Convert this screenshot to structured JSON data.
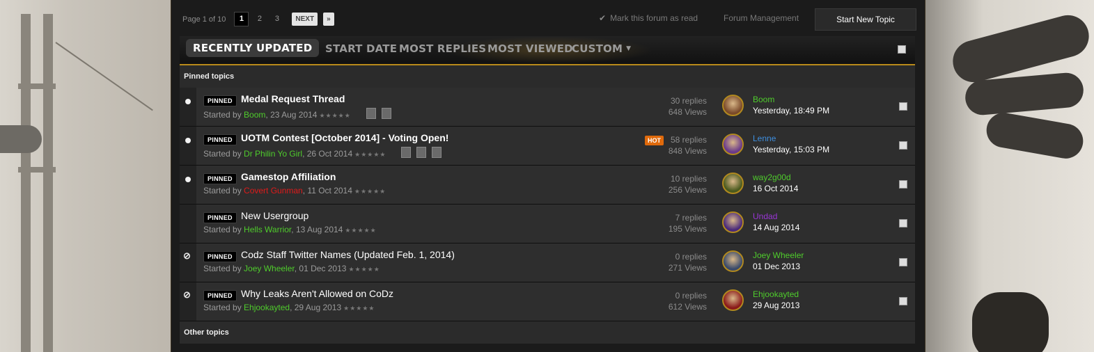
{
  "pagination": {
    "label": "Page 1 of 10",
    "pages": [
      "1",
      "2",
      "3"
    ],
    "next_label": "NEXT",
    "last_label": "»"
  },
  "actions": {
    "mark_read": "Mark this forum as read",
    "forum_management": "Forum Management",
    "start_new_topic": "Start New Topic"
  },
  "tabs": [
    "RECENTLY UPDATED",
    "START DATE",
    "MOST REPLIES",
    "MOST VIEWED",
    "CUSTOM"
  ],
  "sections": {
    "pinned": "Pinned topics",
    "other": "Other topics"
  },
  "badges": {
    "pinned": "PINNED",
    "hot": "HOT"
  },
  "started_by_prefix": "Started by ",
  "colors": {
    "accent": "#b98a1a",
    "user_green": "#4fcc2c",
    "user_blue": "#3e8fe0",
    "user_red": "#e01a1a",
    "user_purple": "#9a35d6",
    "hot": "#e06a0c"
  },
  "topics": [
    {
      "title": "Medal Request Thread",
      "bold": true,
      "status_icon": "unread-dot-icon",
      "starter": "Boom",
      "starter_color": "#4fcc2c",
      "date": "23 Aug 2014",
      "stars": "★★★★★",
      "mini_pages": 2,
      "hot": false,
      "replies": "30 replies",
      "views": "648 Views",
      "last_user": "Boom",
      "last_user_color": "#4fcc2c",
      "last_date": "Yesterday, 18:49 PM"
    },
    {
      "title": "UOTM Contest [October 2014] - Voting Open!",
      "bold": true,
      "status_icon": "unread-dot-icon",
      "starter": "Dr Philin Yo Girl",
      "starter_color": "#4fcc2c",
      "date": "26 Oct 2014",
      "stars": "★★★★★",
      "mini_pages": 3,
      "hot": true,
      "replies": "58 replies",
      "views": "848 Views",
      "last_user": "Lenne",
      "last_user_color": "#3e8fe0",
      "last_date": "Yesterday, 15:03 PM"
    },
    {
      "title": "Gamestop Affiliation",
      "bold": true,
      "status_icon": "unread-dot-icon",
      "starter": "Covert Gunman",
      "starter_color": "#e01a1a",
      "date": "11 Oct 2014",
      "stars": "★★★★★",
      "mini_pages": 0,
      "hot": false,
      "replies": "10 replies",
      "views": "256 Views",
      "last_user": "way2g00d",
      "last_user_color": "#4fcc2c",
      "last_date": "16 Oct 2014"
    },
    {
      "title": "New Usergroup",
      "bold": false,
      "status_icon": "none",
      "starter": "Hells Warrior",
      "starter_color": "#4fcc2c",
      "date": "13 Aug 2014",
      "stars": "★★★★★",
      "mini_pages": 0,
      "hot": false,
      "replies": "7 replies",
      "views": "195 Views",
      "last_user": "Undad",
      "last_user_color": "#9a35d6",
      "last_date": "14 Aug 2014"
    },
    {
      "title": "Codz Staff Twitter Names (Updated Feb. 1, 2014)",
      "bold": false,
      "status_icon": "locked-icon",
      "starter": "Joey Wheeler",
      "starter_color": "#4fcc2c",
      "date": "01 Dec 2013",
      "stars": "★★★★★",
      "mini_pages": 0,
      "hot": false,
      "replies": "0 replies",
      "views": "271 Views",
      "last_user": "Joey Wheeler",
      "last_user_color": "#4fcc2c",
      "last_date": "01 Dec 2013"
    },
    {
      "title": "Why Leaks Aren't Allowed on CoDz",
      "bold": false,
      "status_icon": "locked-icon",
      "starter": "Ehjookayted",
      "starter_color": "#4fcc2c",
      "date": "29 Aug 2013",
      "stars": "★★★★★",
      "mini_pages": 0,
      "hot": false,
      "replies": "0 replies",
      "views": "612 Views",
      "last_user": "Ehjookayted",
      "last_user_color": "#4fcc2c",
      "last_date": "29 Aug 2013"
    }
  ]
}
